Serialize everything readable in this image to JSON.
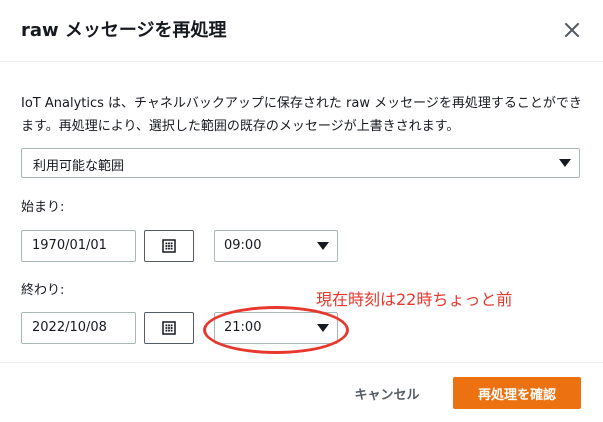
{
  "modal": {
    "title": "raw メッセージを再処理",
    "description": "IoT Analytics は、チャネルバックアップに保存された raw メッセージを再処理することができます。再処理により、選択した範囲の既存のメッセージが上書きされます。"
  },
  "range_select": {
    "value": "利用可能な範囲"
  },
  "start": {
    "label": "始まり:",
    "date": "1970/01/01",
    "time": "09:00"
  },
  "end": {
    "label": "終わり:",
    "date": "2022/10/08",
    "time": "21:00"
  },
  "buttons": {
    "cancel": "キャンセル",
    "confirm": "再処理を確認"
  },
  "annotation": {
    "text": "現在時刻は22時ちょっと前",
    "color": "#e8372c"
  },
  "colors": {
    "primary": "#ec7211",
    "text": "#16191f",
    "border": "#aab7b8"
  },
  "icons": {
    "close": "close-icon",
    "calendar": "calendar-icon",
    "dropdown": "caret-down-icon"
  }
}
